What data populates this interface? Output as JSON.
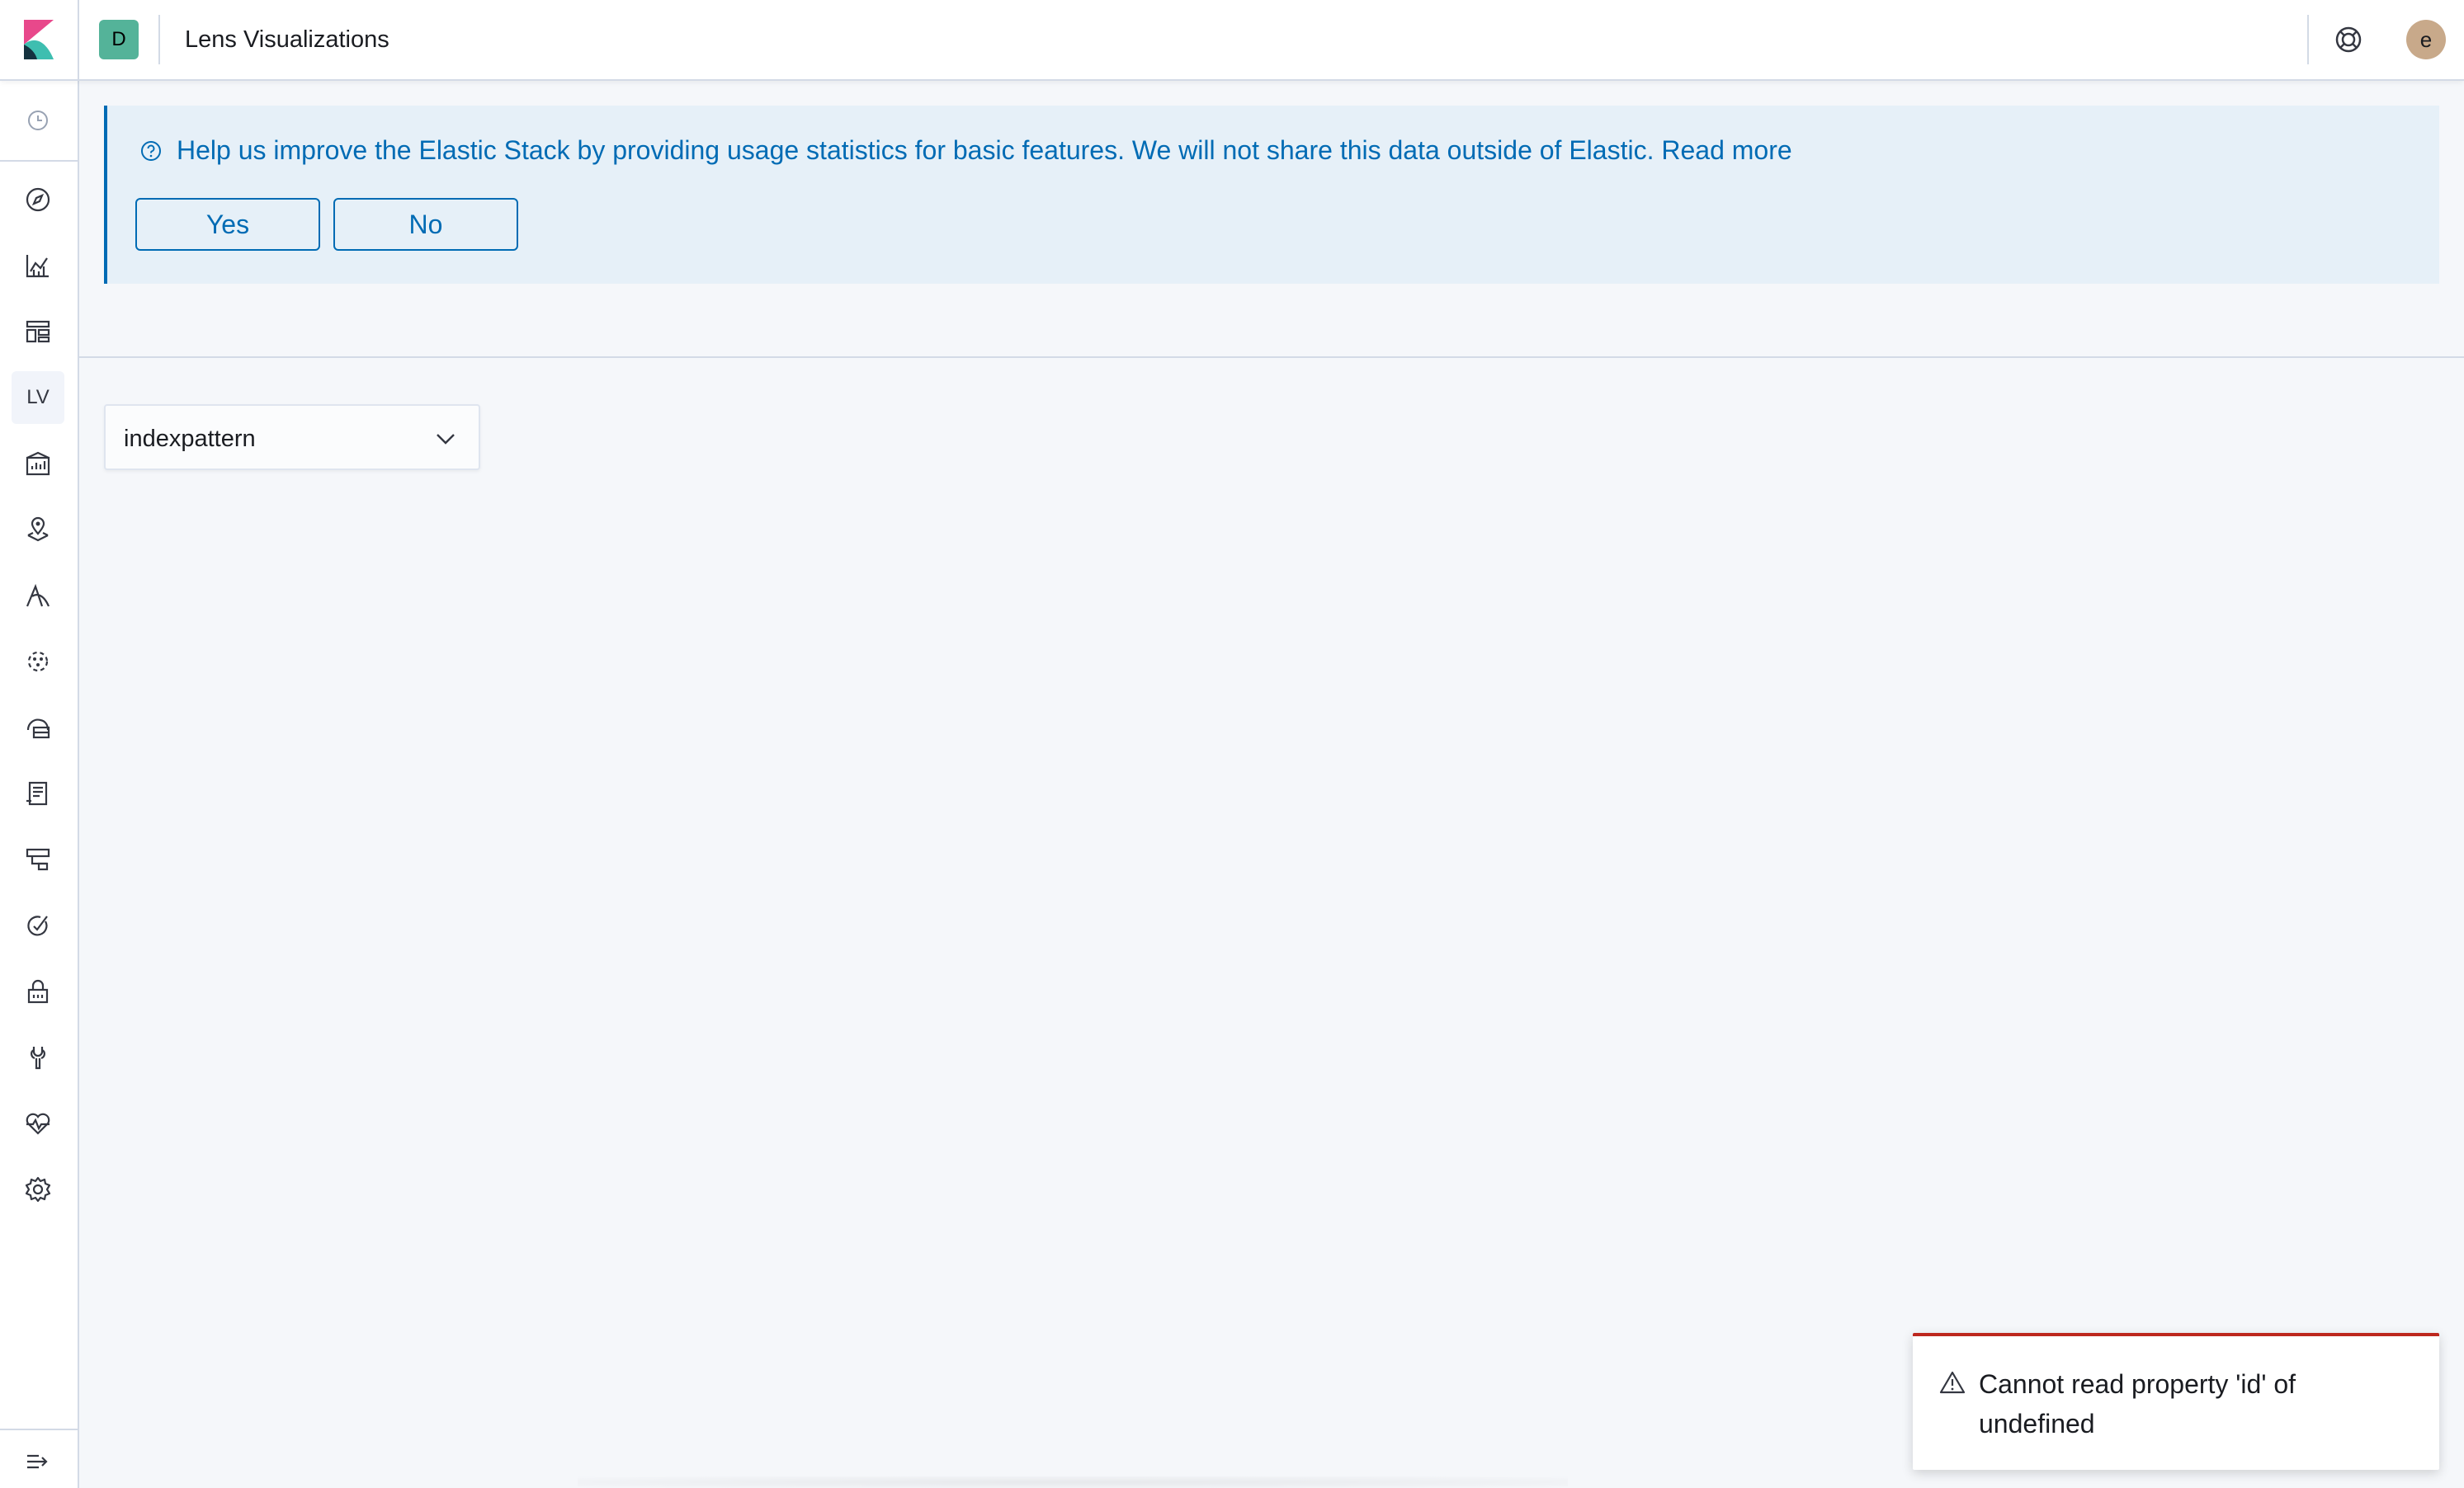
{
  "header": {
    "space_initial": "D",
    "app_title": "Lens Visualizations",
    "user_initial": "e"
  },
  "sidebar": {
    "items": [
      {
        "name": "recently-viewed",
        "icon": "clock-icon"
      },
      {
        "name": "discover",
        "icon": "compass-icon"
      },
      {
        "name": "visualize",
        "icon": "chart-icon"
      },
      {
        "name": "dashboard",
        "icon": "dashboard-icon"
      },
      {
        "name": "lens-visualizations",
        "label": "LV",
        "active": true
      },
      {
        "name": "canvas",
        "icon": "canvas-icon"
      },
      {
        "name": "maps",
        "icon": "map-pin-icon"
      },
      {
        "name": "apm",
        "icon": "apm-icon"
      },
      {
        "name": "machine-learning",
        "icon": "ml-icon"
      },
      {
        "name": "infrastructure",
        "icon": "infrastructure-icon"
      },
      {
        "name": "logs",
        "icon": "logs-icon"
      },
      {
        "name": "uptime",
        "icon": "uptime-icon"
      },
      {
        "name": "siem",
        "icon": "siem-icon"
      },
      {
        "name": "security",
        "icon": "lock-icon"
      },
      {
        "name": "dev-tools",
        "icon": "wrench-icon"
      },
      {
        "name": "monitoring",
        "icon": "heartbeat-icon"
      },
      {
        "name": "management",
        "icon": "gear-icon"
      },
      {
        "name": "collapse",
        "icon": "collapse-icon"
      }
    ]
  },
  "callout": {
    "text": "Help us improve the Elastic Stack by providing usage statistics for basic features. We will not share this data outside of Elastic. Read more",
    "yes_label": "Yes",
    "no_label": "No"
  },
  "index_select": {
    "value": "indexpattern"
  },
  "toast": {
    "message": "Cannot read property 'id' of undefined"
  },
  "colors": {
    "accent": "#006bb4",
    "danger": "#bd271e",
    "space_badge": "#54b399"
  }
}
